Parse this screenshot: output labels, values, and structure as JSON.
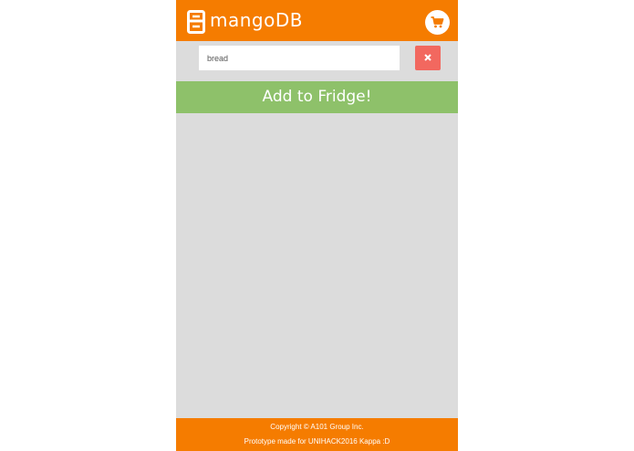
{
  "header": {
    "title": "mangoDB",
    "logo_icon": "fridge-icon",
    "cart_icon": "cart-icon"
  },
  "search": {
    "value": "bread",
    "clear_icon": "close-icon"
  },
  "actions": {
    "add_label": "Add to Fridge!"
  },
  "footer": {
    "copyright": "Copyright © A101 Group Inc.",
    "note": "Prototype made for UNIHACK2016 Kappa :D"
  },
  "colors": {
    "brand_orange": "#f57c00",
    "add_green": "#8ec16a",
    "clear_red": "#f2685f",
    "background_gray": "#dcdcdc"
  }
}
